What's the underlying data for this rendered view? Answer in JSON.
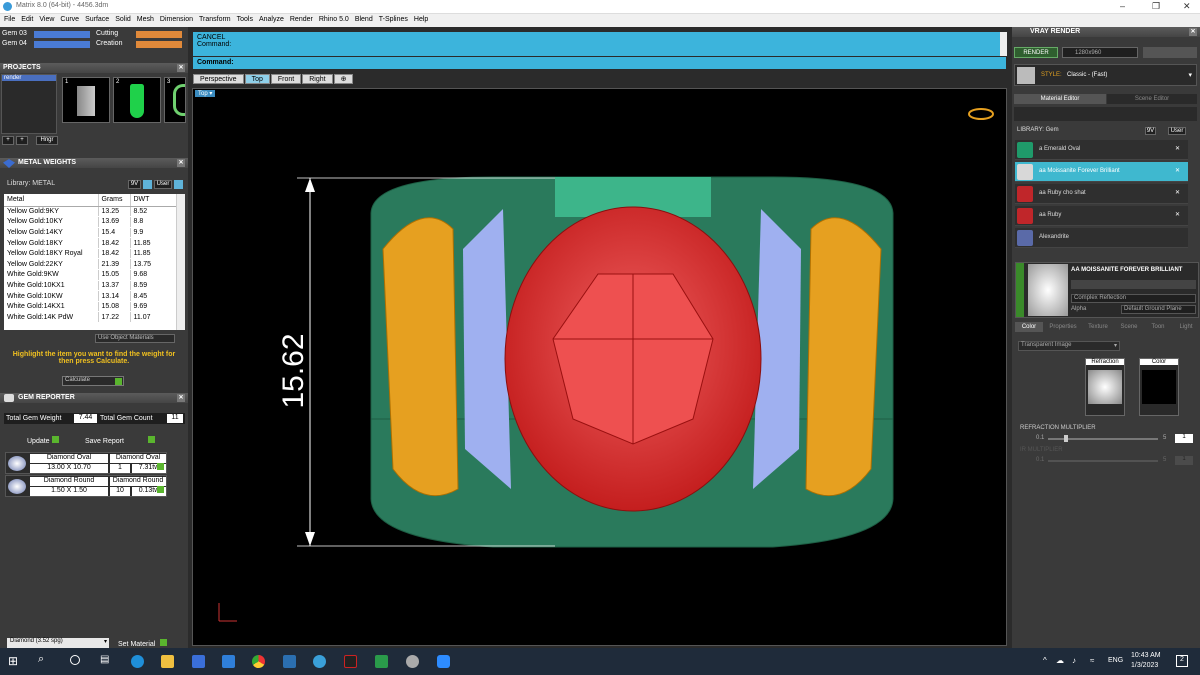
{
  "window": {
    "title": "Matrix 8.0 (64-bit) - 4456.3dm"
  },
  "menu": [
    "File",
    "Edit",
    "View",
    "Curve",
    "Surface",
    "Solid",
    "Mesh",
    "Dimension",
    "Transform",
    "Tools",
    "Analyze",
    "Render",
    "Rhino 5.0",
    "Blend",
    "T-Splines",
    "Help"
  ],
  "layers": [
    {
      "name": "Gem 03"
    },
    {
      "name": "Gem 04"
    },
    {
      "name": "Cutting"
    },
    {
      "name": "Creation"
    }
  ],
  "projects": {
    "title": "PROJECTS",
    "item": "render",
    "thumbs": [
      "1",
      "2",
      "3"
    ],
    "hinge": "Hngr"
  },
  "metal_weights": {
    "title": "METAL WEIGHTS",
    "library_label": "Library: METAL",
    "btn_9v": "9V",
    "btn_user": "User",
    "columns": [
      "Metal",
      "Grams",
      "DWT"
    ],
    "rows": [
      [
        "Yellow Gold:9KY",
        "13.25",
        "8.52"
      ],
      [
        "Yellow Gold:10KY",
        "13.69",
        "8.8"
      ],
      [
        "Yellow Gold:14KY",
        "15.4",
        "9.9"
      ],
      [
        "Yellow Gold:18KY",
        "18.42",
        "11.85"
      ],
      [
        "Yellow Gold:18KY Royal",
        "18.42",
        "11.85"
      ],
      [
        "Yellow Gold:22KY",
        "21.39",
        "13.75"
      ],
      [
        "White Gold:9KW",
        "15.05",
        "9.68"
      ],
      [
        "White Gold:10KX1",
        "13.37",
        "8.59"
      ],
      [
        "White Gold:10KW",
        "13.14",
        "8.45"
      ],
      [
        "White Gold:14KX1",
        "15.08",
        "9.69"
      ],
      [
        "White Gold:14K PdW",
        "17.22",
        "11.07"
      ]
    ],
    "use_object": "Use Object Materials",
    "hint": "Highlight the item you want to find the weight for then press Calculate.",
    "calculate": "Calculate"
  },
  "gem_reporter": {
    "title": "GEM REPORTER",
    "total_weight_label": "Total Gem Weight",
    "total_weight": "7.44",
    "total_count_label": "Total Gem Count",
    "total_count": "11",
    "update": "Update",
    "save_report": "Save Report",
    "gems": [
      {
        "name": "Diamond Oval",
        "size": "13.00 X 10.70",
        "count": "1",
        "weight": "7.31tw"
      },
      {
        "name": "Diamond Round",
        "size": "1.50 X 1.50",
        "count": "10",
        "weight": "0.13tw"
      }
    ]
  },
  "bottom_left": {
    "material": "Diamond",
    "sg": "(3.52 spg)",
    "set_material": "Set Material"
  },
  "command": {
    "cancel": "CANCEL",
    "prompt": "Command:",
    "input_label": "Command:"
  },
  "viewports": {
    "tabs": [
      "Perspective",
      "Top",
      "Front",
      "Right"
    ],
    "active": "Top",
    "label": "Top",
    "dimension": "15.62"
  },
  "vray": {
    "title": "VRAY RENDER",
    "render_btn": "RENDER",
    "resolution": "1280x960",
    "style_label": "STYLE:",
    "style_value": "Classic - (Fast)",
    "tabs": [
      "Material Editor",
      "Scene Editor"
    ],
    "library": "LIBRARY: Gem",
    "btn_9v": "9V",
    "btn_user": "User",
    "materials": [
      {
        "name": "a Emerald Oval",
        "color": "#1f9a6a"
      },
      {
        "name": "aa Moissanite Forever Brilliant",
        "color": "#d8d8d8"
      },
      {
        "name": "aa Ruby cho shat",
        "color": "#c0262a"
      },
      {
        "name": "aa Ruby",
        "color": "#c0262a"
      },
      {
        "name": "Alexandrite",
        "color": "#5a6aa8"
      }
    ],
    "selected_material": "AA MOISSANITE FOREVER BRILLIANT",
    "preset": "Complex Reflection",
    "alpha": "Alpha",
    "ground": "Default Ground Plane",
    "sub_tabs": [
      "Color",
      "Properties",
      "Texture",
      "Scene",
      "Toon",
      "Light"
    ],
    "transparent": "Transparent Image",
    "refraction": "Refraction",
    "color": "Color",
    "refraction_multiplier": "REFRACTION MULTIPLIER",
    "rm_min": "0.1",
    "rm_max": "5",
    "rm_val": "1",
    "ir_multiplier": "IR MULTIPLIER",
    "ir_min": "0.1",
    "ir_max": "5",
    "ir_val": "1"
  },
  "taskbar": {
    "lang": "ENG",
    "time": "10:43 AM",
    "date": "1/3/2023",
    "badge": "2"
  }
}
